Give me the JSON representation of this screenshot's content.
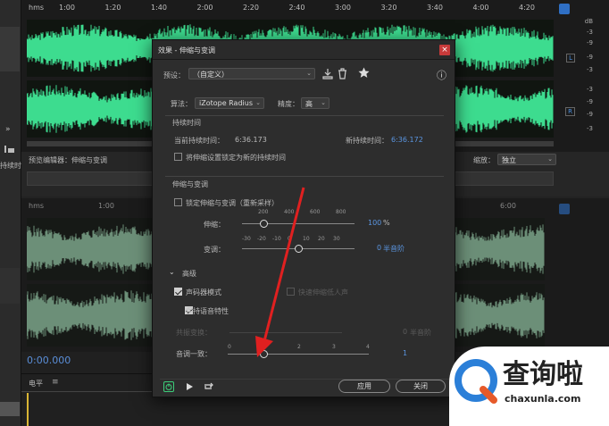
{
  "editor": {
    "ruler_unit": "hms",
    "ruler_ticks": [
      "1:00",
      "1:20",
      "1:40",
      "2:00",
      "2:20",
      "2:40",
      "3:00",
      "3:20",
      "3:40",
      "4:00",
      "4:20"
    ],
    "db_unit": "dB",
    "db_labels_top": [
      "-3",
      "-9",
      "-9",
      "-3"
    ],
    "db_labels_bottom": [
      "-3",
      "-9",
      "-9",
      "-3"
    ],
    "channel_left": "L",
    "channel_right": "R",
    "left_panel_text": "持续时",
    "preview_label": "预览编辑器：伸缩与变调",
    "zoom_label": "缩放：",
    "zoom_value": "独立",
    "preview_ruler_unit": "hms",
    "preview_ruler_ticks": [
      "1:00",
      "6:00"
    ],
    "timecode": "0:00.000",
    "level_label": "电平"
  },
  "dialog": {
    "title": "效果 - 伸缩与变调",
    "close_label": "×",
    "preset_label": "预设：",
    "preset_value": "（自定义）",
    "info_icon": "ⓘ",
    "algorithm_label": "算法：",
    "algorithm_value": "iZotope Radius",
    "precision_label": "精度：",
    "precision_value": "高",
    "duration_section": "持续时间",
    "current_duration_label": "当前持续时间：",
    "current_duration_value": "6:36.173",
    "new_duration_label": "新持续时间：",
    "new_duration_value": "6:36.172",
    "lock_duration_label": "将伸缩设置锁定为新的持续时间",
    "stretch_pitch_section": "伸缩与变调",
    "lock_stretch_label": "锁定伸缩与变调（重新采样）",
    "stretch_label": "伸缩：",
    "stretch_scale": [
      "200",
      "400",
      "600",
      "800"
    ],
    "stretch_value": "100",
    "stretch_unit": "%",
    "pitch_label": "变调：",
    "pitch_scale": [
      "-30",
      "-20",
      "-10",
      "0",
      "10",
      "20",
      "30"
    ],
    "pitch_value": "0",
    "pitch_unit": "半音阶",
    "advanced_label": "高级",
    "vocoder_label": "声码器模式",
    "hidden_option_label": "快速伸缩低人声",
    "preserve_speech_label": "保持语音特性",
    "formant_label": "共振变换：",
    "formant_value": "0",
    "formant_unit": "半音阶",
    "pitch_coherence_label": "音调一致：",
    "coherence_scale": [
      "0",
      "2",
      "3",
      "4"
    ],
    "coherence_value": "1",
    "apply_label": "应用",
    "close_button_label": "关闭"
  },
  "watermark": {
    "brand": "查询啦",
    "url": "chaxunla.com"
  },
  "slider_levels": {
    "stretch_fraction": 0.0,
    "pitch_fraction": 0.5,
    "coherence_fraction": 0.25
  },
  "colors": {
    "waveform": "#3ddc8f",
    "waveform_dim": "#6c8f78",
    "accent_blue": "#5a95e0",
    "arrow_red": "#e02020",
    "close_red": "#c73a3a",
    "logo_blue": "#2b7fd8"
  }
}
